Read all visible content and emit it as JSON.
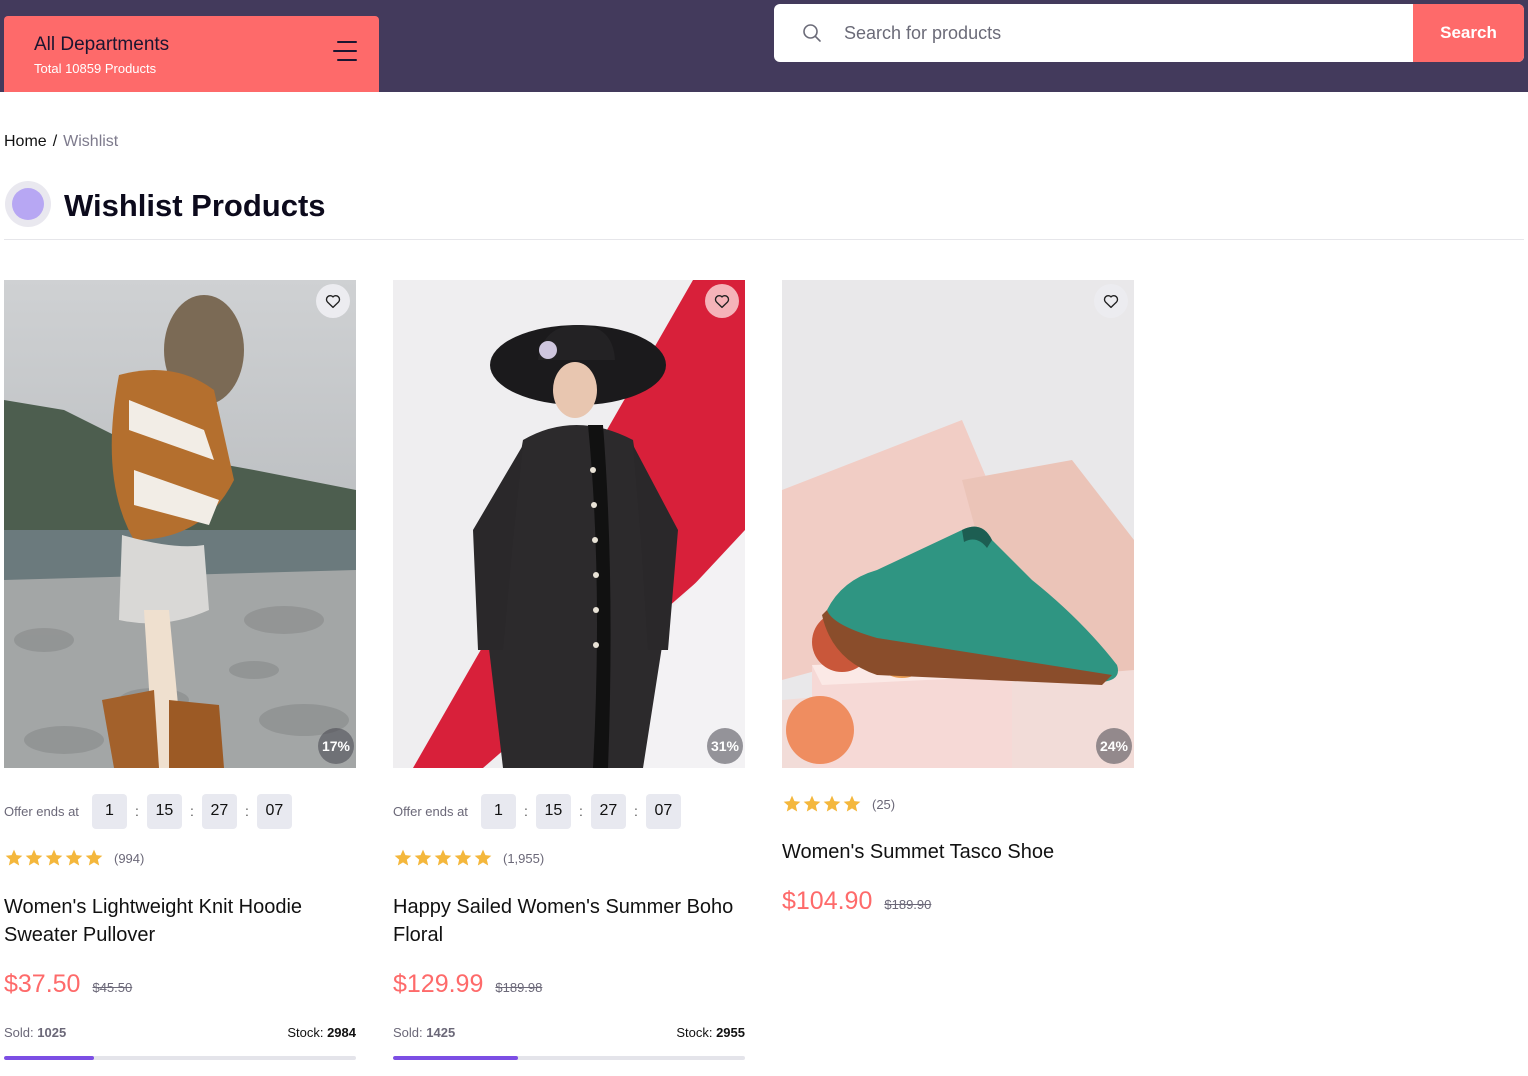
{
  "header": {
    "departments_title": "All Departments",
    "departments_subtitle": "Total 10859 Products",
    "search_placeholder": "Search for products",
    "search_button": "Search"
  },
  "breadcrumb": {
    "home": "Home",
    "separator": "/",
    "current": "Wishlist"
  },
  "page": {
    "title": "Wishlist Products"
  },
  "colors": {
    "accent": "#fe6a6a",
    "header_bg": "#433a5c",
    "progress": "#7c4ee4",
    "star": "#f4b73c"
  },
  "products": [
    {
      "name": "Women's Lightweight Knit Hoodie Sweater Pullover",
      "discount": "17%",
      "offer_label": "Offer ends at",
      "timer": [
        "1",
        "15",
        "27",
        "07"
      ],
      "rating": 5,
      "rating_count": "(994)",
      "price": "$37.50",
      "old_price": "$45.50",
      "sold_label": "Sold:",
      "sold": "1025",
      "stock_label": "Stock:",
      "stock": "2984",
      "sold_fraction": 0.256
    },
    {
      "name": "Happy Sailed Women's Summer Boho Floral",
      "discount": "31%",
      "offer_label": "Offer ends at",
      "timer": [
        "1",
        "15",
        "27",
        "07"
      ],
      "rating": 5,
      "rating_count": "(1,955)",
      "price": "$129.99",
      "old_price": "$189.98",
      "sold_label": "Sold:",
      "sold": "1425",
      "stock_label": "Stock:",
      "stock": "2955",
      "sold_fraction": 0.355
    },
    {
      "name": "Women's Summet Tasco Shoe",
      "discount": "24%",
      "rating": 4,
      "rating_count": "(25)",
      "price": "$104.90",
      "old_price": "$189.90"
    }
  ]
}
